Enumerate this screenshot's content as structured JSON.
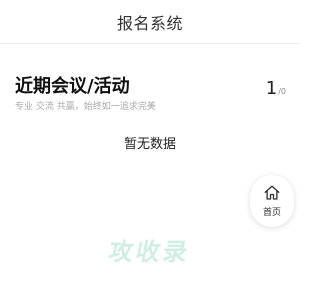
{
  "navbar": {
    "title": "报名系统"
  },
  "section": {
    "title": "近期会议/活动",
    "subtitle": "专业 交流 共赢，始终如一追求完美"
  },
  "pager": {
    "current": "1",
    "separator": "/",
    "total": "0"
  },
  "empty_state": {
    "text": "暂无数据"
  },
  "home_button": {
    "icon": "home-icon",
    "label": "首页"
  },
  "watermark": {
    "text": "攻收录"
  },
  "colors": {
    "watermark": "#cfeee4",
    "subtitle": "#aaaaaa",
    "divider": "#ececec"
  }
}
